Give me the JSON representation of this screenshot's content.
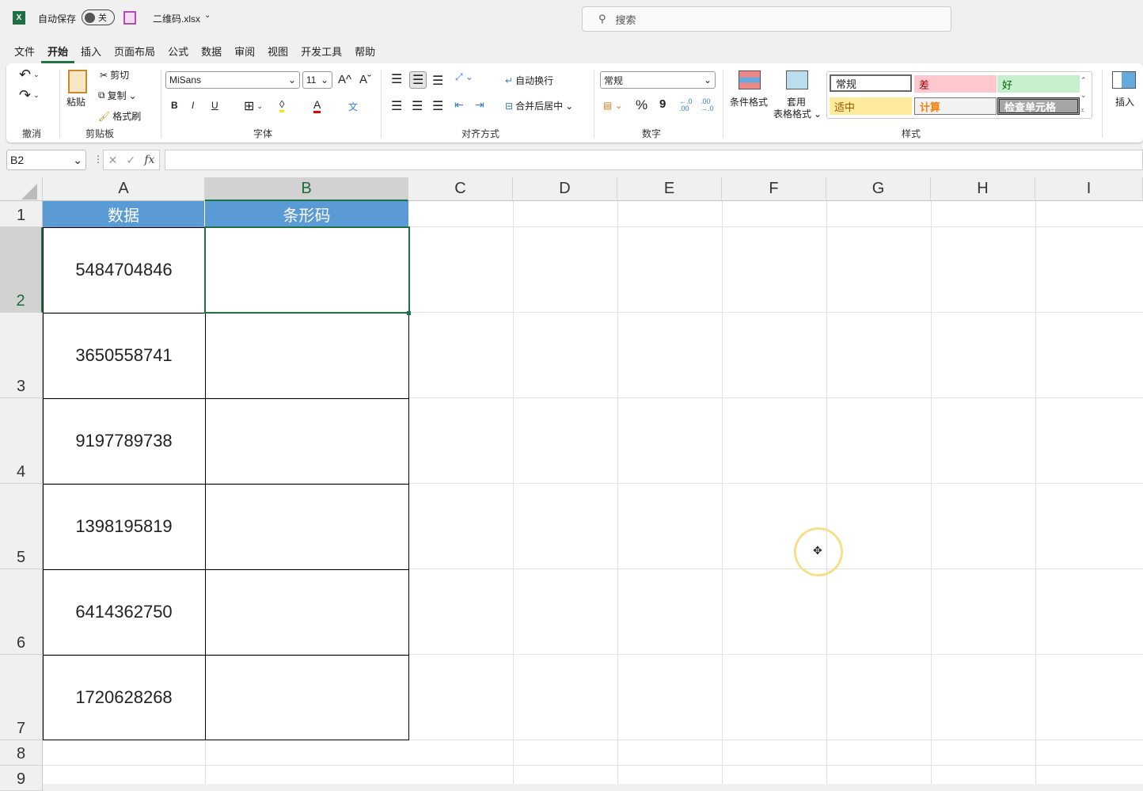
{
  "titlebar": {
    "autosave_label": "自动保存",
    "autosave_state": "关",
    "filename": "二维码.xlsx",
    "search_placeholder": "搜索"
  },
  "menu": [
    "文件",
    "开始",
    "插入",
    "页面布局",
    "公式",
    "数据",
    "审阅",
    "视图",
    "开发工具",
    "帮助"
  ],
  "ribbon": {
    "undo_group": "撤消",
    "clipboard": {
      "paste": "粘贴",
      "cut": "剪切",
      "copy": "复制",
      "format_painter": "格式刷",
      "group": "剪贴板"
    },
    "font": {
      "name": "MiSans",
      "size": "11",
      "bold": "B",
      "italic": "I",
      "underline": "U",
      "grow": "A^",
      "shrink": "Aˇ",
      "font_color": "A",
      "phonetic": "文",
      "group": "字体"
    },
    "alignment": {
      "wrap": "自动换行",
      "merge": "合并后居中",
      "group": "对齐方式"
    },
    "number": {
      "format": "常规",
      "percent": "%",
      "comma": "9",
      "inc_decimal": "←.0 .00",
      "dec_decimal": ".00 →.0",
      "group": "数字"
    },
    "styles": {
      "conditional": "条件格式",
      "table_format_1": "套用",
      "table_format_2": "表格格式",
      "cells": [
        {
          "label": "常规",
          "bg": "#ffffff",
          "color": "#000000"
        },
        {
          "label": "差",
          "bg": "#ffc7ce",
          "color": "#9c0006"
        },
        {
          "label": "好",
          "bg": "#c6efce",
          "color": "#006100"
        },
        {
          "label": "适中",
          "bg": "#ffeb9c",
          "color": "#9c5700"
        },
        {
          "label": "计算",
          "bg": "#f2f2f2",
          "color": "#fa7d00"
        },
        {
          "label": "检查单元格",
          "bg": "#a5a5a5",
          "color": "#ffffff"
        }
      ],
      "group": "样式"
    },
    "insert": "插入"
  },
  "formula_bar": {
    "name_box": "B2",
    "fx": "fx",
    "value": ""
  },
  "sheet": {
    "columns": [
      "A",
      "B",
      "C",
      "D",
      "E",
      "F",
      "G",
      "H",
      "I"
    ],
    "rows": [
      "1",
      "2",
      "3",
      "4",
      "5",
      "6",
      "7",
      "8",
      "9"
    ],
    "header": {
      "a": "数据",
      "b": "条形码"
    },
    "data": [
      "5484704846",
      "3650558741",
      "9197789738",
      "1398195819",
      "6414362750",
      "1720628268"
    ],
    "header_color": "#5b9bd5",
    "selected": "B2"
  }
}
